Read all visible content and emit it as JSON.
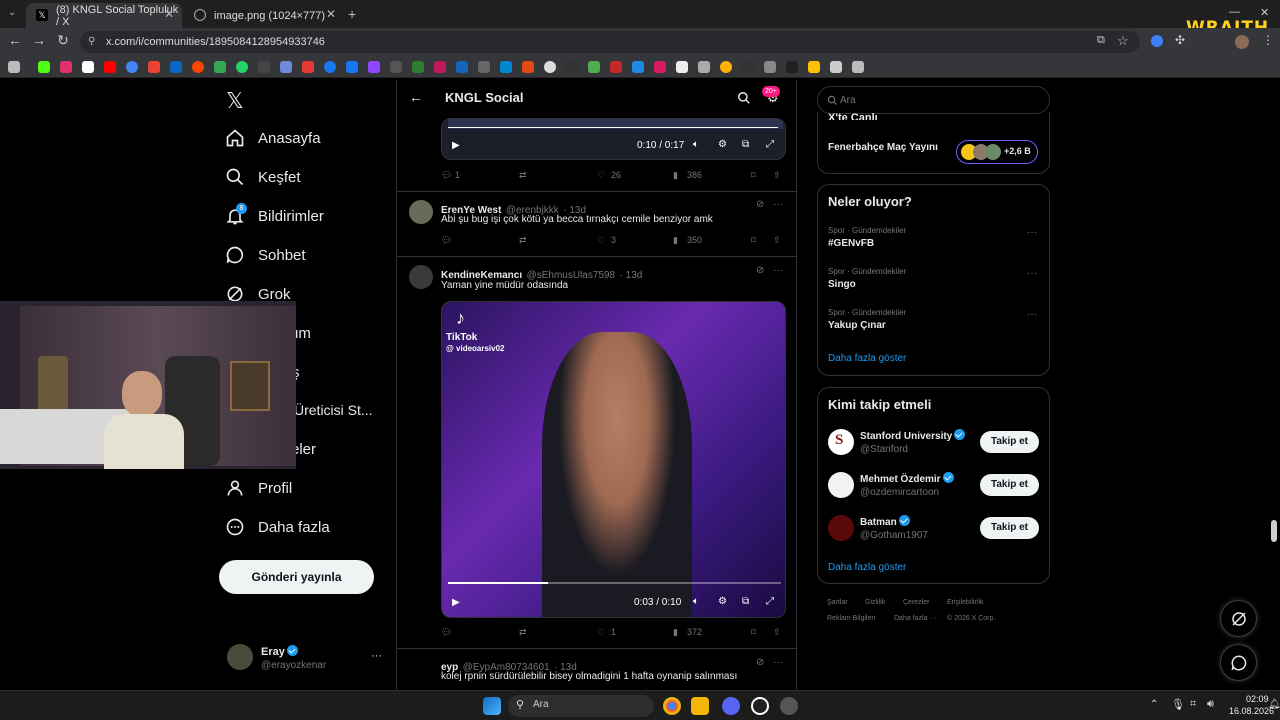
{
  "browser": {
    "tabs": [
      {
        "title": "(8) KNGL Social Topluluk / X",
        "active": true
      },
      {
        "title": "image.png (1024×777)",
        "active": false
      }
    ],
    "url": "x.com/i/communities/1895084128954933746",
    "overlay_logo": "WRAITH",
    "new_tab": "+"
  },
  "nav": {
    "items": [
      {
        "label": "Anasayfa",
        "icon": "home-icon"
      },
      {
        "label": "Keşfet",
        "icon": "search-icon"
      },
      {
        "label": "Bildirimler",
        "icon": "bell-icon",
        "badge": "8"
      },
      {
        "label": "Sohbet",
        "icon": "chat-icon"
      },
      {
        "label": "Grok",
        "icon": "grok-icon"
      },
      {
        "label": "um"
      },
      {
        "label": "ş"
      },
      {
        "label": "Üreticisi St..."
      },
      {
        "label": "eler"
      },
      {
        "label": "Profil",
        "icon": "person-icon"
      },
      {
        "label": "Daha fazla",
        "icon": "more-icon"
      }
    ],
    "post_button": "Gönderi yayınla",
    "account": {
      "name": "Eray",
      "handle": "@erayozkenar"
    }
  },
  "header": {
    "title": "KNGL Social",
    "badge": "20+"
  },
  "tweets": [
    {
      "video_time": "0:10 / 0:17",
      "stats": {
        "replies": "1",
        "likes": "26",
        "views": "386"
      }
    },
    {
      "name": "ErenYe West",
      "handle": "@erenbjkkk",
      "time": "· 13d",
      "text": "Abi şu bug işi çok kötü ya becca tırnakçı cemile benziyor amk",
      "stats": {
        "replies": "",
        "likes": "3",
        "views": "350"
      }
    },
    {
      "name": "KendineKemancı",
      "handle": "@sEhmusUlas7598",
      "time": "· 13d",
      "text": "Yaman yine müdür odasında",
      "video_brand": "TikTok",
      "video_user": "@ videoarsiv02",
      "video_time": "0:03 / 0:10",
      "stats": {
        "replies": "",
        "likes": "1",
        "views": "372"
      }
    },
    {
      "name": "eyp",
      "handle": "@EypAm80734601",
      "time": "· 13d",
      "text": "kolej rpnin sürdürülebilir bisey olmadigini 1 hafta oynanip salınması"
    }
  ],
  "right": {
    "search_placeholder": "Ara",
    "live": {
      "title": "X'te Canlı",
      "event": "Fenerbahçe Maç Yayını",
      "count": "+2,6 B"
    },
    "trends": {
      "title": "Neler oluyor?",
      "items": [
        {
          "category": "Spor · Gündemdekiler",
          "name": "#GENvFB"
        },
        {
          "category": "Spor · Gündemdekiler",
          "name": "Singo"
        },
        {
          "category": "Spor · Gündemdekiler",
          "name": "Yakup Çınar"
        }
      ],
      "more": "Daha fazla göster"
    },
    "follow": {
      "title": "Kimi takip etmeli",
      "items": [
        {
          "name": "Stanford University",
          "handle": "@Stanford",
          "button": "Takip et"
        },
        {
          "name": "Mehmet Özdemir",
          "handle": "@ozdemircartoon",
          "button": "Takip et"
        },
        {
          "name": "Batman",
          "handle": "@Gotham1907",
          "button": "Takip et"
        }
      ],
      "more": "Daha fazla göster"
    },
    "footer": {
      "links": [
        "Şartlar",
        "Gizlilik",
        "Çerezler",
        "Erişilebilirlik",
        "Reklam Bilgileri",
        "Daha fazla ···"
      ],
      "copyright": "© 2026 X Corp."
    }
  },
  "taskbar": {
    "search": "Ara",
    "time": "02:09",
    "date": "16.08.2026"
  },
  "colors": {
    "accent": "#1d9bf0",
    "bg": "#000000",
    "border": "#2f3336",
    "muted": "#71767b",
    "badge": "#f91880"
  }
}
